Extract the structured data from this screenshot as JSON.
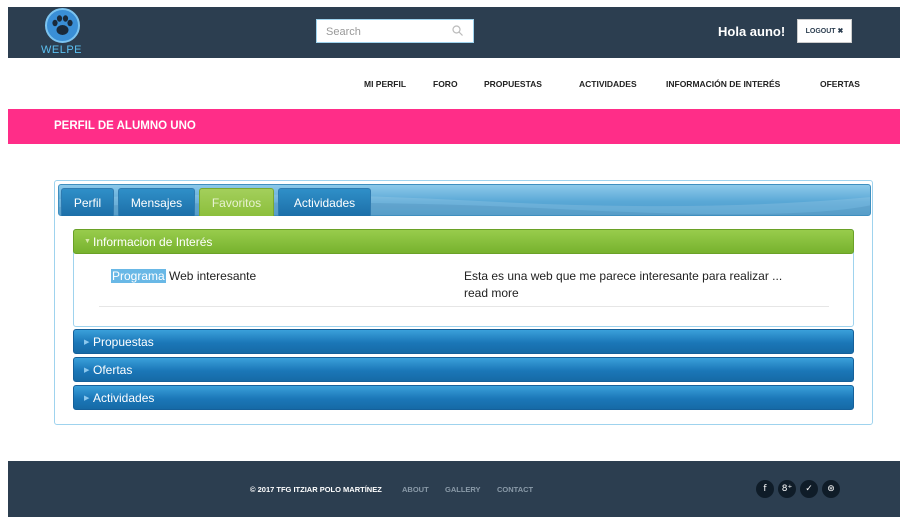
{
  "header": {
    "logo_text": "WELPE",
    "search_placeholder": "Search",
    "greeting": "Hola auno!",
    "logout_label": "LOGOUT ✖"
  },
  "nav": {
    "items": [
      "MI PERFIL",
      "FORO",
      "PROPUESTAS",
      "ACTIVIDADES",
      "INFORMACIÓN DE INTERÉS",
      "OFERTAS"
    ]
  },
  "banner": {
    "title": "PERFIL DE ALUMNO UNO"
  },
  "tabs": {
    "items": [
      "Perfil",
      "Mensajes",
      "Favoritos",
      "Actividades"
    ],
    "active": "Favoritos"
  },
  "accordion": {
    "open_section": {
      "title": "Informacion de Interés",
      "rows": [
        {
          "title_highlight": "Programa",
          "title_rest": " Web interesante",
          "description": "Esta es una web que me parece interesante para realizar ...",
          "more": "read more"
        }
      ]
    },
    "closed_sections": [
      "Propuestas",
      "Ofertas",
      "Actividades"
    ]
  },
  "footer": {
    "copyright": "© 2017 TFG ITZIAR POLO MARTÍNEZ",
    "links": [
      "ABOUT",
      "GALLERY",
      "CONTACT"
    ],
    "social": [
      "f",
      "8⁺",
      "✓",
      "⊛"
    ],
    "social_icons": [
      "facebook-icon",
      "google-plus-icon",
      "twitter-icon",
      "dribbble-icon"
    ]
  },
  "colors": {
    "header_bg": "#2c3e50",
    "banner_pink": "#ff2d88",
    "tab_blue": "#1d6fa8",
    "accent_green": "#8cbf3c"
  }
}
